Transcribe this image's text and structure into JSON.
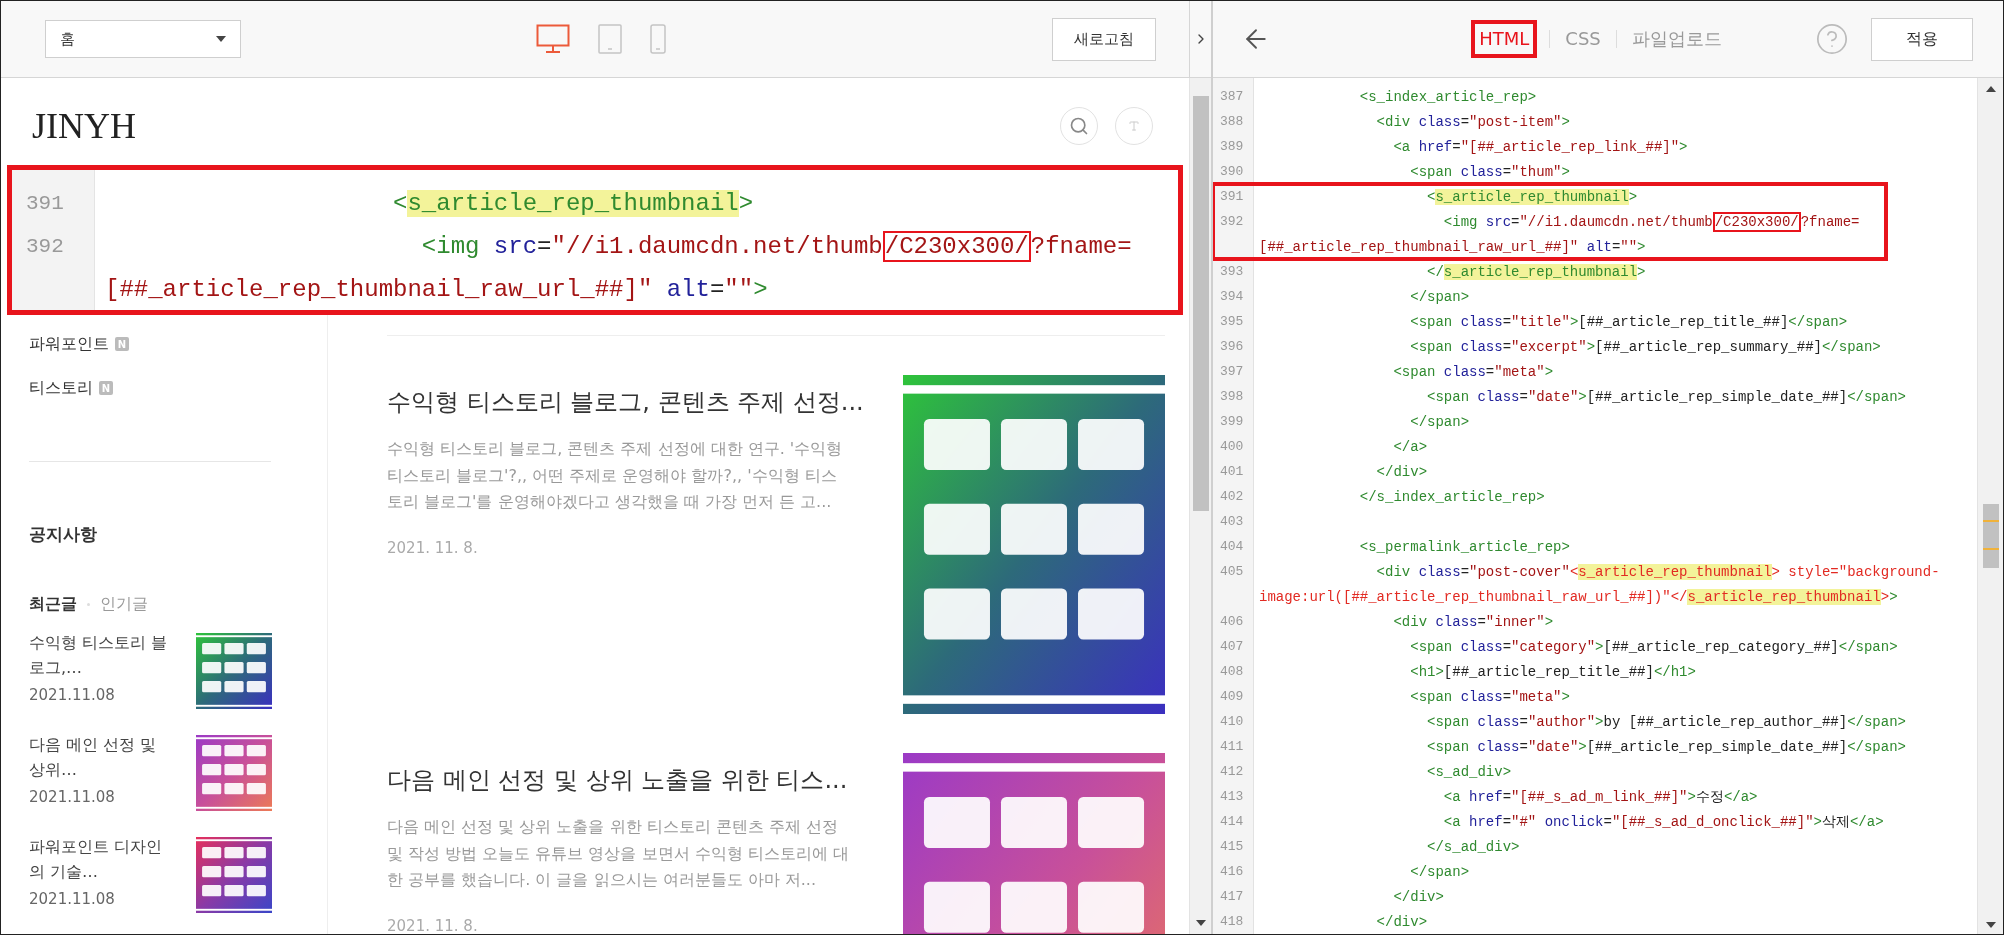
{
  "editor_toolbar": {
    "page_select": {
      "value": "홈"
    },
    "devices": [
      {
        "kind": "desktop",
        "selected": true
      },
      {
        "kind": "tablet",
        "selected": false
      },
      {
        "kind": "mobile",
        "selected": false
      }
    ],
    "refresh_button": "새로고침"
  },
  "blog": {
    "title": "JINYH",
    "categories": [
      {
        "label": "파워포인트",
        "badge": "N"
      },
      {
        "label": "티스토리",
        "badge": "N"
      }
    ],
    "notice_heading": "공지사항",
    "list_tabs": [
      {
        "label": "최근글",
        "selected": true
      },
      {
        "label": "인기글",
        "selected": false
      }
    ],
    "recent_posts": [
      {
        "title": "수익형 티스토리 블로그,…",
        "date": "2021.11.08"
      },
      {
        "title": "다음 메인 선정 및 상위…",
        "date": "2021.11.08"
      },
      {
        "title": "파워포인트 디자인의 기술…",
        "date": "2021.11.08"
      }
    ],
    "posts": [
      {
        "title": "수익형 티스토리 블로그, 콘텐츠 주제 선정...",
        "excerpt": "수익형 티스토리 블로그, 콘텐츠 주제 선정에 대한 연구. '수익형 티스토리 블로그'?,, 어떤 주제로 운영해야 할까?,, '수익형 티스토리 블로그'를 운영해야겠다고 생각했을 때 가장 먼저 든 고...",
        "date": "2021. 11. 8."
      },
      {
        "title": "다음 메인 선정 및 상위 노출을 위한 티스...",
        "excerpt": "다음 메인 선정 및 상위 노출을 위한 티스토리 콘텐츠 주제 선정 및 작성 방법 오늘도 유튜브 영상을 보면서 수익형 티스토리에 대한 공부를 했습니다. 이 글을 읽으시는 여러분들도 아마 저...",
        "date": "2021. 11. 8."
      }
    ]
  },
  "zoom_callout": {
    "rows": [
      {
        "kind": "line",
        "number": "391",
        "segments": [
          {
            "kind": "tag",
            "text": "                    <"
          },
          {
            "kind": "tag_hl",
            "text": "s_article_rep_thumbnail"
          },
          {
            "kind": "tag",
            "text": ">"
          }
        ]
      },
      {
        "kind": "line",
        "number": "392",
        "segments": [
          {
            "kind": "tag",
            "text": "                      <img"
          },
          {
            "kind": "attr",
            "text": " src"
          },
          {
            "kind": "plain",
            "text": "="
          },
          {
            "kind": "str",
            "text": "\"//i1.daumcdn.net/thumb"
          },
          {
            "kind": "str_boxed",
            "text": "/C230x300/"
          },
          {
            "kind": "str",
            "text": "?fname="
          }
        ]
      },
      {
        "kind": "line",
        "segments": [
          {
            "kind": "str",
            "text": "[##_article_rep_thumbnail_raw_url_##]\""
          },
          {
            "kind": "attr",
            "text": " alt"
          },
          {
            "kind": "plain",
            "text": "="
          },
          {
            "kind": "str",
            "text": "\"\""
          },
          {
            "kind": "tag",
            "text": ">"
          }
        ]
      }
    ]
  },
  "code_editor": {
    "tabs": [
      {
        "label": "HTML",
        "selected": true,
        "boxed": true
      },
      {
        "label": "CSS",
        "selected": false,
        "boxed": false
      },
      {
        "label": "파일업로드",
        "selected": false,
        "boxed": false
      }
    ],
    "apply_button": "적용",
    "rows": [
      {
        "kind": "line",
        "number": "387",
        "segments": [
          {
            "kind": "tag",
            "text": "            <s_index_article_rep>"
          }
        ]
      },
      {
        "kind": "line",
        "number": "388",
        "segments": [
          {
            "kind": "tag",
            "text": "              <div"
          },
          {
            "kind": "attr",
            "text": " class"
          },
          {
            "kind": "plain",
            "text": "="
          },
          {
            "kind": "str",
            "text": "\"post-item\""
          },
          {
            "kind": "tag",
            "text": ">"
          }
        ]
      },
      {
        "kind": "line",
        "number": "389",
        "segments": [
          {
            "kind": "tag",
            "text": "                <a"
          },
          {
            "kind": "attr",
            "text": " href"
          },
          {
            "kind": "plain",
            "text": "="
          },
          {
            "kind": "str",
            "text": "\"[##_article_rep_link_##]\""
          },
          {
            "kind": "tag",
            "text": ">"
          }
        ]
      },
      {
        "kind": "line",
        "number": "390",
        "segments": [
          {
            "kind": "tag",
            "text": "                  <span"
          },
          {
            "kind": "attr",
            "text": " class"
          },
          {
            "kind": "plain",
            "text": "="
          },
          {
            "kind": "str",
            "text": "\"thum\""
          },
          {
            "kind": "tag",
            "text": ">"
          }
        ]
      },
      {
        "kind": "framed",
        "rows": [
          {
            "kind": "line",
            "number": "391",
            "segments": [
              {
                "kind": "tag",
                "text": "                    <"
              },
              {
                "kind": "tag_hl",
                "text": "s_article_rep_thumbnail"
              },
              {
                "kind": "tag",
                "text": ">"
              }
            ]
          },
          {
            "kind": "line",
            "number": "392",
            "segments": [
              {
                "kind": "tag",
                "text": "                      <img"
              },
              {
                "kind": "attr",
                "text": " src"
              },
              {
                "kind": "plain",
                "text": "="
              },
              {
                "kind": "str",
                "text": "\"//i1.daumcdn.net/thumb"
              },
              {
                "kind": "str_boxed",
                "text": "/C230x300/"
              },
              {
                "kind": "str",
                "text": "?fname="
              }
            ]
          },
          {
            "kind": "line",
            "segments": [
              {
                "kind": "str",
                "text": "[##_article_rep_thumbnail_raw_url_##]\""
              },
              {
                "kind": "attr",
                "text": " alt"
              },
              {
                "kind": "plain",
                "text": "="
              },
              {
                "kind": "str",
                "text": "\"\""
              },
              {
                "kind": "tag",
                "text": ">"
              }
            ]
          }
        ]
      },
      {
        "kind": "line",
        "number": "393",
        "segments": [
          {
            "kind": "tag",
            "text": "                    </"
          },
          {
            "kind": "tag_hl",
            "text": "s_article_rep_thumbnail"
          },
          {
            "kind": "tag",
            "text": ">"
          }
        ]
      },
      {
        "kind": "line",
        "number": "394",
        "segments": [
          {
            "kind": "tag",
            "text": "                  </span>"
          }
        ]
      },
      {
        "kind": "line",
        "number": "395",
        "segments": [
          {
            "kind": "tag",
            "text": "                  <span"
          },
          {
            "kind": "attr",
            "text": " class"
          },
          {
            "kind": "plain",
            "text": "="
          },
          {
            "kind": "str",
            "text": "\"title\""
          },
          {
            "kind": "tag",
            "text": ">"
          },
          {
            "kind": "plain",
            "text": "[##_article_rep_title_##]"
          },
          {
            "kind": "tag",
            "text": "</span>"
          }
        ]
      },
      {
        "kind": "line",
        "number": "396",
        "segments": [
          {
            "kind": "tag",
            "text": "                  <span"
          },
          {
            "kind": "attr",
            "text": " class"
          },
          {
            "kind": "plain",
            "text": "="
          },
          {
            "kind": "str",
            "text": "\"excerpt\""
          },
          {
            "kind": "tag",
            "text": ">"
          },
          {
            "kind": "plain",
            "text": "[##_article_rep_summary_##]"
          },
          {
            "kind": "tag",
            "text": "</span>"
          }
        ]
      },
      {
        "kind": "line",
        "number": "397",
        "segments": [
          {
            "kind": "tag",
            "text": "                <span"
          },
          {
            "kind": "attr",
            "text": " class"
          },
          {
            "kind": "plain",
            "text": "="
          },
          {
            "kind": "str",
            "text": "\"meta\""
          },
          {
            "kind": "tag",
            "text": ">"
          }
        ]
      },
      {
        "kind": "line",
        "number": "398",
        "segments": [
          {
            "kind": "tag",
            "text": "                    <span"
          },
          {
            "kind": "attr",
            "text": " class"
          },
          {
            "kind": "plain",
            "text": "="
          },
          {
            "kind": "str",
            "text": "\"date\""
          },
          {
            "kind": "tag",
            "text": ">"
          },
          {
            "kind": "plain",
            "text": "[##_article_rep_simple_date_##]"
          },
          {
            "kind": "tag",
            "text": "</span>"
          }
        ]
      },
      {
        "kind": "line",
        "number": "399",
        "segments": [
          {
            "kind": "tag",
            "text": "                  </span>"
          }
        ]
      },
      {
        "kind": "line",
        "number": "400",
        "segments": [
          {
            "kind": "tag",
            "text": "                </a>"
          }
        ]
      },
      {
        "kind": "line",
        "number": "401",
        "segments": [
          {
            "kind": "tag",
            "text": "              </div>"
          }
        ]
      },
      {
        "kind": "line",
        "number": "402",
        "segments": [
          {
            "kind": "tag",
            "text": "            </s_index_article_rep>"
          }
        ]
      },
      {
        "kind": "line",
        "number": "403"
      },
      {
        "kind": "line",
        "number": "404",
        "segments": [
          {
            "kind": "tag",
            "text": "            <s_permalink_article_rep>"
          }
        ]
      },
      {
        "kind": "line",
        "number": "405",
        "segments": [
          {
            "kind": "tag",
            "text": "              <div"
          },
          {
            "kind": "attr",
            "text": " class"
          },
          {
            "kind": "plain",
            "text": "="
          },
          {
            "kind": "str",
            "text": "\"post-cover\""
          },
          {
            "kind": "red",
            "text": "<"
          },
          {
            "kind": "red_hl",
            "text": "s_article_rep_thumbnail"
          },
          {
            "kind": "red",
            "text": "> style=\"background-"
          }
        ]
      },
      {
        "kind": "line",
        "segments": [
          {
            "kind": "red",
            "text": "image:url([##_article_rep_thumbnail_raw_url_##])\"</"
          },
          {
            "kind": "red_hl",
            "text": "s_article_rep_thumbnail"
          },
          {
            "kind": "red",
            "text": ">"
          },
          {
            "kind": "tag",
            "text": ">"
          }
        ]
      },
      {
        "kind": "line",
        "number": "406",
        "segments": [
          {
            "kind": "tag",
            "text": "                <div"
          },
          {
            "kind": "attr",
            "text": " class"
          },
          {
            "kind": "plain",
            "text": "="
          },
          {
            "kind": "str",
            "text": "\"inner\""
          },
          {
            "kind": "tag",
            "text": ">"
          }
        ]
      },
      {
        "kind": "line",
        "number": "407",
        "segments": [
          {
            "kind": "tag",
            "text": "                  <span"
          },
          {
            "kind": "attr",
            "text": " class"
          },
          {
            "kind": "plain",
            "text": "="
          },
          {
            "kind": "str",
            "text": "\"category\""
          },
          {
            "kind": "tag",
            "text": ">"
          },
          {
            "kind": "plain",
            "text": "[##_article_rep_category_##]"
          },
          {
            "kind": "tag",
            "text": "</span>"
          }
        ]
      },
      {
        "kind": "line",
        "number": "408",
        "segments": [
          {
            "kind": "tag",
            "text": "                  <h1>"
          },
          {
            "kind": "plain",
            "text": "[##_article_rep_title_##]"
          },
          {
            "kind": "tag",
            "text": "</h1>"
          }
        ]
      },
      {
        "kind": "line",
        "number": "409",
        "segments": [
          {
            "kind": "tag",
            "text": "                  <span"
          },
          {
            "kind": "attr",
            "text": " class"
          },
          {
            "kind": "plain",
            "text": "="
          },
          {
            "kind": "str",
            "text": "\"meta\""
          },
          {
            "kind": "tag",
            "text": ">"
          }
        ]
      },
      {
        "kind": "line",
        "number": "410",
        "segments": [
          {
            "kind": "tag",
            "text": "                    <span"
          },
          {
            "kind": "attr",
            "text": " class"
          },
          {
            "kind": "plain",
            "text": "="
          },
          {
            "kind": "str",
            "text": "\"author\""
          },
          {
            "kind": "tag",
            "text": ">"
          },
          {
            "kind": "plain",
            "text": "by [##_article_rep_author_##]"
          },
          {
            "kind": "tag",
            "text": "</span>"
          }
        ]
      },
      {
        "kind": "line",
        "number": "411",
        "segments": [
          {
            "kind": "tag",
            "text": "                    <span"
          },
          {
            "kind": "attr",
            "text": " class"
          },
          {
            "kind": "plain",
            "text": "="
          },
          {
            "kind": "str",
            "text": "\"date\""
          },
          {
            "kind": "tag",
            "text": ">"
          },
          {
            "kind": "plain",
            "text": "[##_article_rep_simple_date_##]"
          },
          {
            "kind": "tag",
            "text": "</span>"
          }
        ]
      },
      {
        "kind": "line",
        "number": "412",
        "segments": [
          {
            "kind": "tag",
            "text": "                    <s_ad_div>"
          }
        ]
      },
      {
        "kind": "line",
        "number": "413",
        "segments": [
          {
            "kind": "tag",
            "text": "                      <a"
          },
          {
            "kind": "attr",
            "text": " href"
          },
          {
            "kind": "plain",
            "text": "="
          },
          {
            "kind": "str",
            "text": "\"[##_s_ad_m_link_##]\""
          },
          {
            "kind": "tag",
            "text": ">"
          },
          {
            "kind": "plain",
            "text": "수정"
          },
          {
            "kind": "tag",
            "text": "</a>"
          }
        ]
      },
      {
        "kind": "line",
        "number": "414",
        "segments": [
          {
            "kind": "tag",
            "text": "                      <a"
          },
          {
            "kind": "attr",
            "text": " href"
          },
          {
            "kind": "plain",
            "text": "="
          },
          {
            "kind": "str",
            "text": "\"#\""
          },
          {
            "kind": "attr",
            "text": " onclick"
          },
          {
            "kind": "plain",
            "text": "="
          },
          {
            "kind": "str",
            "text": "\"[##_s_ad_d_onclick_##]\""
          },
          {
            "kind": "tag",
            "text": ">"
          },
          {
            "kind": "plain",
            "text": "삭제"
          },
          {
            "kind": "tag",
            "text": "</a>"
          }
        ]
      },
      {
        "kind": "line",
        "number": "415",
        "segments": [
          {
            "kind": "tag",
            "text": "                    </s_ad_div>"
          }
        ]
      },
      {
        "kind": "line",
        "number": "416",
        "segments": [
          {
            "kind": "tag",
            "text": "                  </span>"
          }
        ]
      },
      {
        "kind": "line",
        "number": "417",
        "segments": [
          {
            "kind": "tag",
            "text": "                </div>"
          }
        ]
      },
      {
        "kind": "line",
        "number": "418",
        "segments": [
          {
            "kind": "tag",
            "text": "              </div>"
          }
        ]
      }
    ]
  }
}
